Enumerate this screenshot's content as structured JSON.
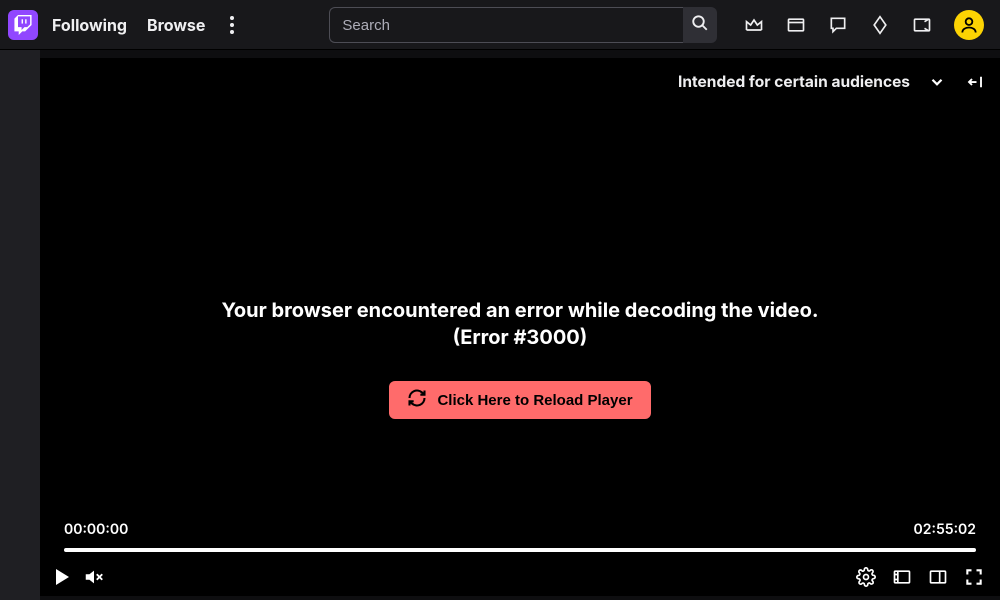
{
  "nav": {
    "following": "Following",
    "browse": "Browse"
  },
  "search": {
    "placeholder": "Search"
  },
  "player": {
    "audience_label": "Intended for certain audiences",
    "error_message": "Your browser encountered an error while decoding the video. (Error #3000)",
    "reload_label": "Click Here to Reload Player",
    "time_current": "00:00:00",
    "time_total": "02:55:02"
  }
}
